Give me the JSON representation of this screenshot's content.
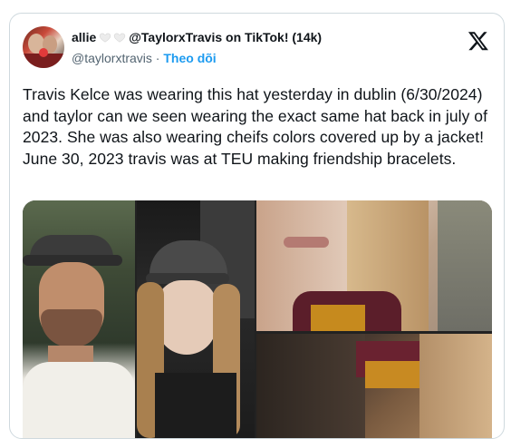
{
  "post": {
    "author_name": "allie",
    "author_name_suffix": "@TaylorxTravis on TikTok! (14k)",
    "handle": "@taylorxtravis",
    "separator": "·",
    "follow_label": "Theo dõi",
    "text": "Travis Kelce was wearing this hat yesterday in dublin (6/30/2024) and taylor can we seen wearing the exact same hat back in july of 2023. She was also wearing cheifs colors covered up by a jacket! June 30, 2023 travis was at TEU making friendship bracelets."
  },
  "icons": {
    "brand": "x-logo-icon",
    "heart": "white-heart-icon"
  },
  "colors": {
    "link": "#1d9bf0",
    "secondary_text": "#536471",
    "border": "#cfd9de"
  }
}
